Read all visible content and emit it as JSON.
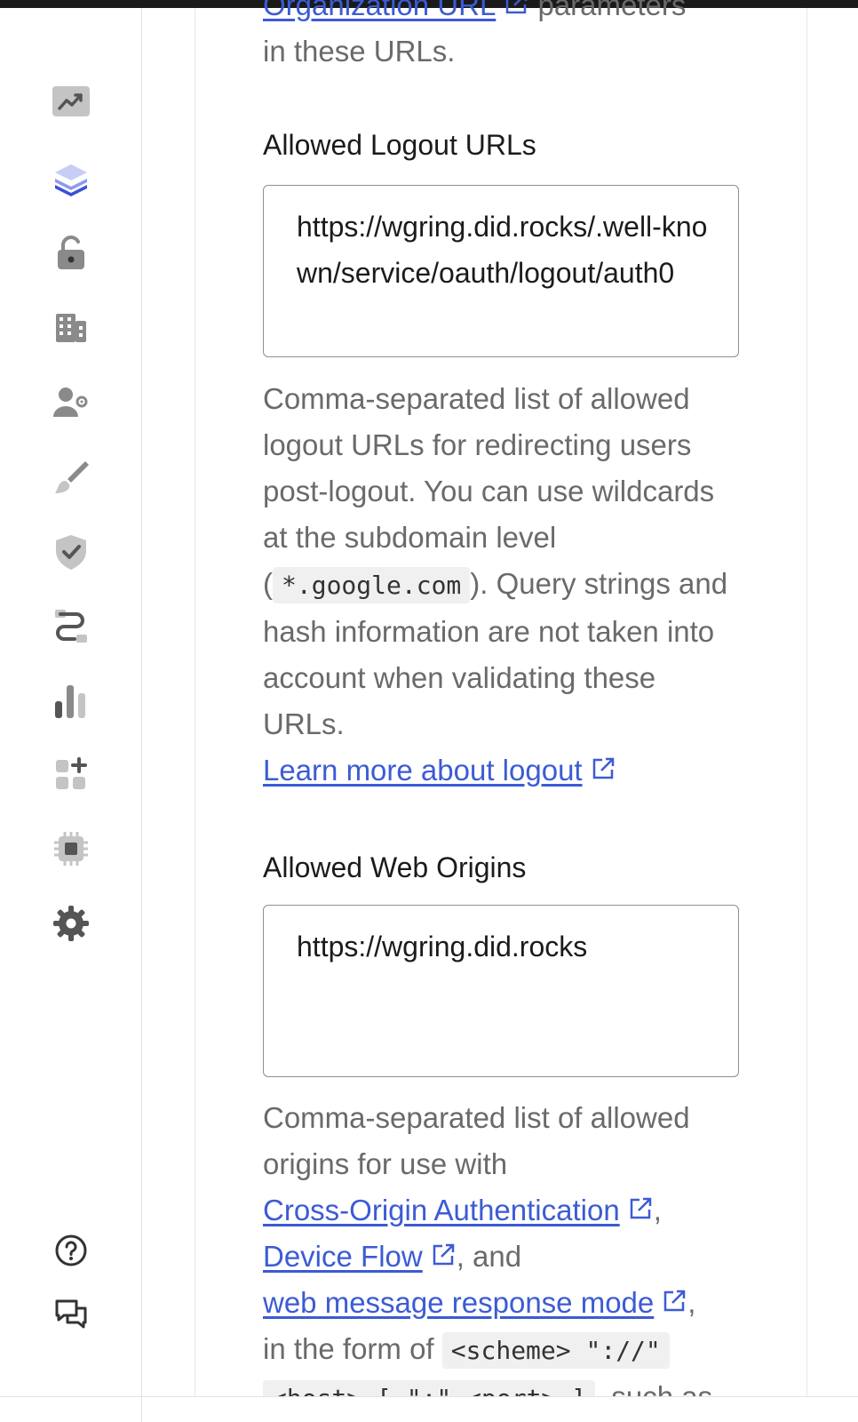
{
  "sidebar": {
    "items": [
      {
        "name": "activity",
        "icon": "trend-chart-icon"
      },
      {
        "name": "applications",
        "icon": "layers-icon"
      },
      {
        "name": "authentication",
        "icon": "unlock-icon"
      },
      {
        "name": "organizations",
        "icon": "building-icon"
      },
      {
        "name": "user-management",
        "icon": "user-settings-icon"
      },
      {
        "name": "branding",
        "icon": "brush-icon"
      },
      {
        "name": "security",
        "icon": "shield-check-icon"
      },
      {
        "name": "actions",
        "icon": "flow-icon"
      },
      {
        "name": "monitoring",
        "icon": "bar-chart-icon"
      },
      {
        "name": "marketplace",
        "icon": "add-apps-icon"
      },
      {
        "name": "extensions",
        "icon": "chip-icon"
      },
      {
        "name": "settings",
        "icon": "gear-icon"
      }
    ],
    "footer": [
      {
        "name": "help",
        "icon": "help-circle-icon"
      },
      {
        "name": "feedback",
        "icon": "chat-icon"
      }
    ]
  },
  "top_fragment": {
    "link": "Organization URL",
    "suffix": " parameters",
    "line2": "in these URLs."
  },
  "logout": {
    "label": "Allowed Logout URLs",
    "value": "https://wgring.did.rocks/.well-known/service/oauth/logout/auth0",
    "help_pre": "Comma-separated list of allowed logout URLs for redirecting users post-logout. You can use wildcards at the subdomain level (",
    "help_code": "*.google.com",
    "help_post": "). Query strings and hash information are not taken into account when validating these URLs.",
    "learn_more": "Learn more about logout"
  },
  "web_origins": {
    "label": "Allowed Web Origins",
    "value": "https://wgring.did.rocks",
    "help_pre": "Comma-separated list of allowed origins for use with",
    "link1": "Cross-Origin Authentication",
    "sep1": ",",
    "link2": "Device Flow",
    "sep2": ", and",
    "link3": "web message response mode",
    "sep3": ",",
    "help_mid": "in the form of",
    "code1": "<scheme> \"://\"",
    "code2": "<host> [ \":\" <port> ]",
    "help_tail": ", such as"
  },
  "colors": {
    "link": "#3c5bd4",
    "text_muted": "#6a6a6a",
    "icon_gray": "#8a8a8a",
    "icon_active": "#3b50d6"
  }
}
